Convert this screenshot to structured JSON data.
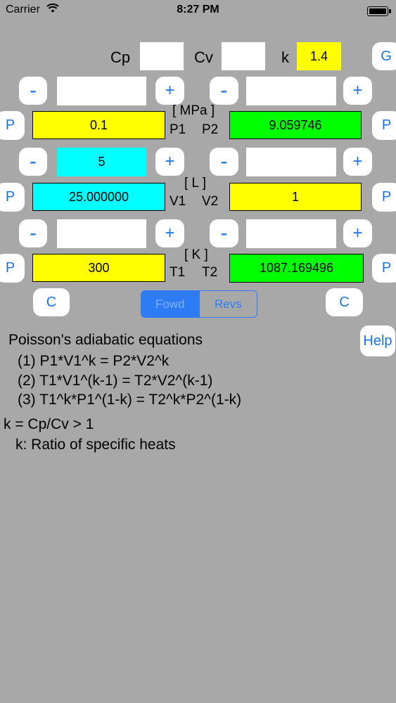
{
  "status": {
    "carrier": "Carrier",
    "time": "8:27 PM"
  },
  "header": {
    "cp_label": "Cp",
    "cv_label": "Cv",
    "k_label": "k",
    "k_value": "1.4",
    "g_button": "G"
  },
  "buttons": {
    "minus": "-",
    "plus": "+",
    "p": "P",
    "c": "C",
    "help": "Help"
  },
  "units": {
    "pressure": "[ MPa ]",
    "volume": "[ L ]",
    "temperature": "[ K ]"
  },
  "rows": {
    "p": {
      "left_label": "P1",
      "right_label": "P2",
      "left_value": "0.1",
      "right_value": "9.059746"
    },
    "v": {
      "left_label": "V1",
      "right_label": "V2",
      "left_value": "25.000000",
      "right_value": "1",
      "left_step": "5"
    },
    "t": {
      "left_label": "T1",
      "right_label": "T2",
      "left_value": "300",
      "right_value": "1087.169496"
    }
  },
  "segmented": {
    "forward": "Fowd",
    "reverse": "Revs"
  },
  "info": {
    "title": "Poisson's adiabatic equations",
    "eq1": "(1) P1*V1^k = P2*V2^k",
    "eq2": "(2) T1*V1^(k-1) = T2*V2^(k-1)",
    "eq3": "(3) T1^k*P1^(1-k) = T2^k*P2^(1-k)",
    "k_def": "k = Cp/Cv > 1",
    "k_desc": "k: Ratio of specific heats"
  },
  "colors": {
    "accent": "#2d7cf6",
    "yellow": "#ffff00",
    "green": "#00ff00",
    "cyan": "#00ffff",
    "background": "#a8a8a8"
  }
}
